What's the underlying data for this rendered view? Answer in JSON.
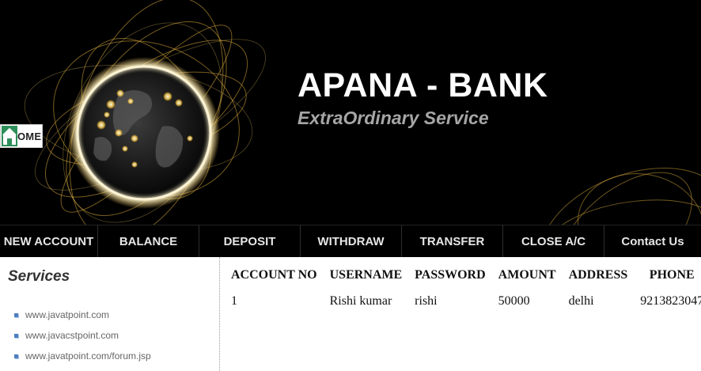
{
  "header": {
    "title": "APANA - BANK",
    "tagline": "ExtraOrdinary Service",
    "home_button": {
      "icon": "home-icon",
      "label": "OME"
    }
  },
  "nav": {
    "items": [
      {
        "label": "NEW ACCOUNT"
      },
      {
        "label": "BALANCE"
      },
      {
        "label": "DEPOSIT"
      },
      {
        "label": "WITHDRAW"
      },
      {
        "label": "TRANSFER"
      },
      {
        "label": "CLOSE A/C"
      },
      {
        "label": "Contact Us"
      }
    ]
  },
  "sidebar": {
    "title": "Services",
    "links": [
      {
        "text": "www.javatpoint.com"
      },
      {
        "text": "www.javacstpoint.com"
      },
      {
        "text": "www.javatpoint.com/forum.jsp"
      }
    ]
  },
  "accounts_table": {
    "columns": [
      "ACCOUNT NO",
      "USERNAME",
      "PASSWORD",
      "AMOUNT",
      "ADDRESS",
      "PHONE"
    ],
    "rows": [
      [
        "1",
        "Rishi kumar",
        "rishi",
        "50000",
        "delhi",
        "9213823047"
      ]
    ]
  },
  "colors": {
    "banner_background": "#000000",
    "title": "#ffffff",
    "tagline": "#a6a6a6",
    "nav_text": "#e6e6e6",
    "glow": "#f2d36b"
  }
}
